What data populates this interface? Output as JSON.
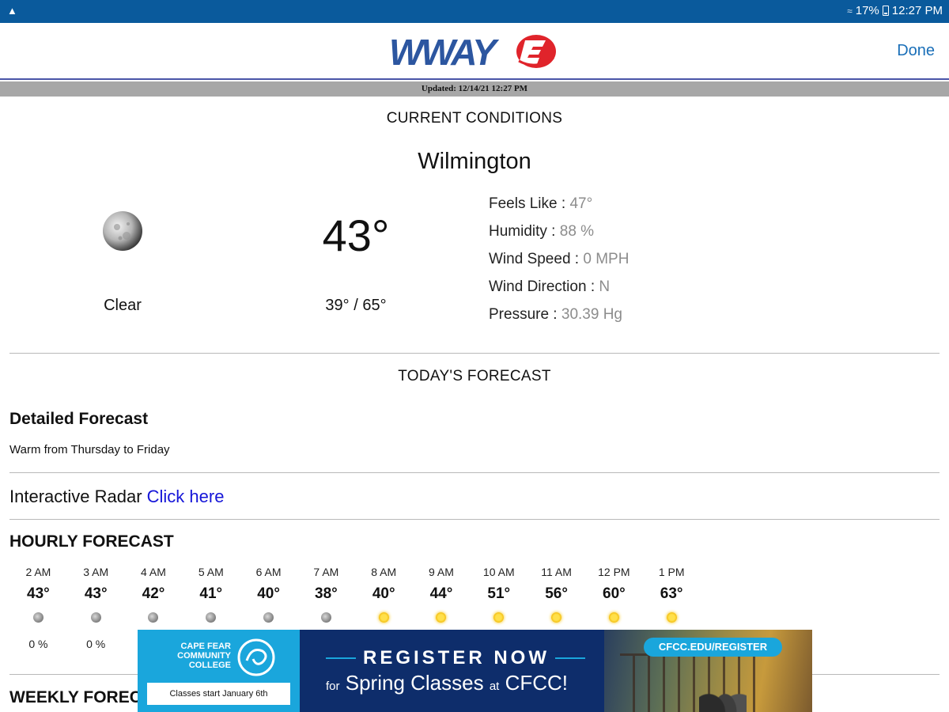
{
  "status_bar": {
    "battery": "17%",
    "time": "12:27 PM"
  },
  "header": {
    "logo_text": "WWAY",
    "done_label": "Done"
  },
  "updated_text": "Updated: 12/14/21 12:27 PM",
  "current": {
    "section_title": "CURRENT CONDITIONS",
    "city": "Wilmington",
    "condition_icon": "moon-icon",
    "condition": "Clear",
    "temperature": "43°",
    "hi_lo": "39° / 65°",
    "details": [
      {
        "label": "Feels Like : ",
        "value": "47°"
      },
      {
        "label": "Humidity : ",
        "value": "88 %"
      },
      {
        "label": "Wind Speed : ",
        "value": "0 MPH"
      },
      {
        "label": "Wind Direction : ",
        "value": "N"
      },
      {
        "label": "Pressure : ",
        "value": "30.39 Hg"
      }
    ]
  },
  "today": {
    "section_title": "TODAY'S FORECAST",
    "detailed_title": "Detailed Forecast",
    "detailed_text": "Warm from Thursday to Friday",
    "radar_label": "Interactive Radar ",
    "radar_link": "Click here"
  },
  "hourly": {
    "title": "HOURLY FORECAST",
    "hours": [
      {
        "time": "2 AM",
        "temp": "43°",
        "icon": "moon-icon",
        "precip": "0 %"
      },
      {
        "time": "3 AM",
        "temp": "43°",
        "icon": "moon-icon",
        "precip": "0 %"
      },
      {
        "time": "4 AM",
        "temp": "42°",
        "icon": "moon-icon",
        "precip": ""
      },
      {
        "time": "5 AM",
        "temp": "41°",
        "icon": "moon-icon",
        "precip": ""
      },
      {
        "time": "6 AM",
        "temp": "40°",
        "icon": "moon-icon",
        "precip": ""
      },
      {
        "time": "7 AM",
        "temp": "38°",
        "icon": "moon-icon",
        "precip": ""
      },
      {
        "time": "8 AM",
        "temp": "40°",
        "icon": "sun-icon",
        "precip": ""
      },
      {
        "time": "9 AM",
        "temp": "44°",
        "icon": "sun-icon",
        "precip": ""
      },
      {
        "time": "10 AM",
        "temp": "51°",
        "icon": "sun-icon",
        "precip": ""
      },
      {
        "time": "11 AM",
        "temp": "56°",
        "icon": "sun-icon",
        "precip": ""
      },
      {
        "time": "12 PM",
        "temp": "60°",
        "icon": "sun-icon",
        "precip": ""
      },
      {
        "time": "1 PM",
        "temp": "63°",
        "icon": "sun-icon",
        "precip": ""
      }
    ]
  },
  "weekly": {
    "title": "WEEKLY FOREC"
  },
  "ad": {
    "college_name": "CAPE FEAR COMMUNITY COLLEGE",
    "pill_text": "Classes start January 6th",
    "headline": "REGISTER NOW",
    "subline_prefix": "for",
    "subline_main": "Spring Classes",
    "subline_at": "at",
    "subline_end": "CFCC!",
    "url": "CFCC.EDU/REGISTER",
    "accent_color": "#1aa6dc",
    "bg_color": "#0e2d6b"
  },
  "colors": {
    "status_bar": "#0a5a9c",
    "link": "#1515d8",
    "done": "#1a6fb8"
  }
}
